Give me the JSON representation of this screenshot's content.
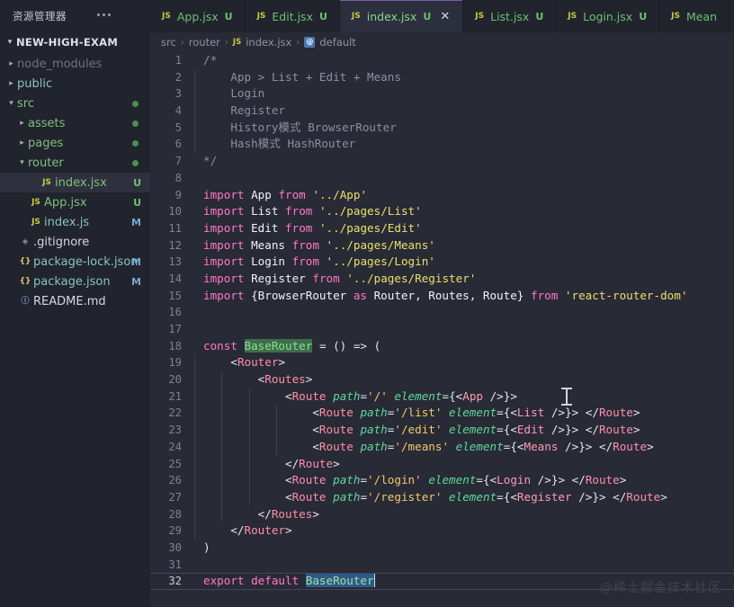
{
  "sidebar": {
    "title": "资源管理器",
    "more_icon": "ellipsis-icon",
    "root_label": "NEW-HIGH-EXAM",
    "items": [
      {
        "label": "node_modules",
        "kind": "folder",
        "indent": 0,
        "twisty": "›",
        "color": "c-dim",
        "icon": "",
        "badge": "",
        "dot": false,
        "selected": false
      },
      {
        "label": "public",
        "kind": "folder",
        "indent": 0,
        "twisty": "›",
        "color": "c-teal",
        "icon": "",
        "badge": "",
        "dot": false,
        "selected": false
      },
      {
        "label": "src",
        "kind": "folder",
        "indent": 0,
        "twisty": "⌄",
        "color": "c-green",
        "icon": "",
        "badge": "",
        "dot": true,
        "selected": false
      },
      {
        "label": "assets",
        "kind": "folder",
        "indent": 1,
        "twisty": "›",
        "color": "c-green",
        "icon": "",
        "badge": "",
        "dot": true,
        "selected": false
      },
      {
        "label": "pages",
        "kind": "folder",
        "indent": 1,
        "twisty": "›",
        "color": "c-green",
        "icon": "",
        "badge": "",
        "dot": true,
        "selected": false
      },
      {
        "label": "router",
        "kind": "folder",
        "indent": 1,
        "twisty": "⌄",
        "color": "c-green",
        "icon": "",
        "badge": "",
        "dot": true,
        "selected": false
      },
      {
        "label": "index.jsx",
        "kind": "file",
        "indent": 2,
        "twisty": "",
        "color": "c-green",
        "icon": "JS",
        "icon_color": "c-js",
        "badge": "U",
        "badge_color": "#6fbf73",
        "dot": false,
        "selected": true
      },
      {
        "label": "App.jsx",
        "kind": "file",
        "indent": 1,
        "twisty": "",
        "color": "c-green",
        "icon": "JS",
        "icon_color": "c-js",
        "badge": "U",
        "badge_color": "#6fbf73",
        "dot": false,
        "selected": false
      },
      {
        "label": "index.js",
        "kind": "file",
        "indent": 1,
        "twisty": "",
        "color": "c-teal",
        "icon": "JS",
        "icon_color": "c-js",
        "badge": "M",
        "badge_color": "#79a6d2",
        "dot": false,
        "selected": false
      },
      {
        "label": ".gitignore",
        "kind": "file",
        "indent": 0,
        "twisty": "",
        "color": "c-white",
        "icon": "◈",
        "icon_color": "c-gitig",
        "badge": "",
        "dot": false,
        "selected": false
      },
      {
        "label": "package-lock.json",
        "kind": "file",
        "indent": 0,
        "twisty": "",
        "color": "c-teal",
        "icon": "{}",
        "icon_color": "c-json",
        "badge": "M",
        "badge_color": "#79a6d2",
        "dot": false,
        "selected": false
      },
      {
        "label": "package.json",
        "kind": "file",
        "indent": 0,
        "twisty": "",
        "color": "c-teal",
        "icon": "{}",
        "icon_color": "c-json",
        "badge": "M",
        "badge_color": "#79a6d2",
        "dot": false,
        "selected": false
      },
      {
        "label": "README.md",
        "kind": "file",
        "indent": 0,
        "twisty": "",
        "color": "c-white",
        "icon": "ⓘ",
        "icon_color": "c-md",
        "badge": "",
        "dot": false,
        "selected": false
      }
    ]
  },
  "tabs": [
    {
      "name": "App.jsx",
      "icon": "JS",
      "badge": "U",
      "active": false,
      "close": false
    },
    {
      "name": "Edit.jsx",
      "icon": "JS",
      "badge": "U",
      "active": false,
      "close": false
    },
    {
      "name": "index.jsx",
      "icon": "JS",
      "badge": "U",
      "active": true,
      "close": true,
      "close_icon": "close-icon"
    },
    {
      "name": "List.jsx",
      "icon": "JS",
      "badge": "U",
      "active": false,
      "close": false
    },
    {
      "name": "Login.jsx",
      "icon": "JS",
      "badge": "U",
      "active": false,
      "close": false
    },
    {
      "name": "Mean",
      "icon": "JS",
      "badge": "",
      "active": false,
      "close": false
    }
  ],
  "breadcrumb": {
    "crumb1": "src",
    "crumb2": "router",
    "file_icon": "JS",
    "crumb3": "index.jsx",
    "symbol_icon": "@",
    "crumb4": "default",
    "separator": "›"
  },
  "editor": {
    "total_lines": 32,
    "current_line": 32,
    "selected_word": "BaseRouter",
    "watermark": "@稀土掘金技术社区",
    "lines": [
      {
        "n": 1,
        "text": "/*"
      },
      {
        "n": 2,
        "text": "    App > List + Edit + Means"
      },
      {
        "n": 3,
        "text": "    Login"
      },
      {
        "n": 4,
        "text": "    Register"
      },
      {
        "n": 5,
        "text": "    History模式 BrowserRouter"
      },
      {
        "n": 6,
        "text": "    Hash模式 HashRouter"
      },
      {
        "n": 7,
        "text": "*/"
      },
      {
        "n": 8,
        "text": ""
      },
      {
        "n": 9,
        "text": "import App from '../App'"
      },
      {
        "n": 10,
        "text": "import List from '../pages/List'"
      },
      {
        "n": 11,
        "text": "import Edit from '../pages/Edit'"
      },
      {
        "n": 12,
        "text": "import Means from '../pages/Means'"
      },
      {
        "n": 13,
        "text": "import Login from '../pages/Login'"
      },
      {
        "n": 14,
        "text": "import Register from '../pages/Register'"
      },
      {
        "n": 15,
        "text": "import {BrowserRouter as Router, Routes, Route} from 'react-router-dom'"
      },
      {
        "n": 16,
        "text": ""
      },
      {
        "n": 17,
        "text": ""
      },
      {
        "n": 18,
        "text": "const BaseRouter = () => ("
      },
      {
        "n": 19,
        "text": "    <Router>"
      },
      {
        "n": 20,
        "text": "        <Routes>"
      },
      {
        "n": 21,
        "text": "            <Route path='/' element={{<App />}}>"
      },
      {
        "n": 22,
        "text": "                <Route path='/list' element={{<List />}}> </Route>"
      },
      {
        "n": 23,
        "text": "                <Route path='/edit' element={{<Edit />}}> </Route>"
      },
      {
        "n": 24,
        "text": "                <Route path='/means' element={{<Means />}}> </Route>"
      },
      {
        "n": 25,
        "text": "            </Route>"
      },
      {
        "n": 26,
        "text": "            <Route path='/login' element={{<Login />}}> </Route>"
      },
      {
        "n": 27,
        "text": "            <Route path='/register' element={{<Register />}}> </Route>"
      },
      {
        "n": 28,
        "text": "        </Routes>"
      },
      {
        "n": 29,
        "text": "    </Router>"
      },
      {
        "n": 30,
        "text": ")"
      },
      {
        "n": 31,
        "text": ""
      },
      {
        "n": 32,
        "text": "export default BaseRouter"
      }
    ]
  }
}
